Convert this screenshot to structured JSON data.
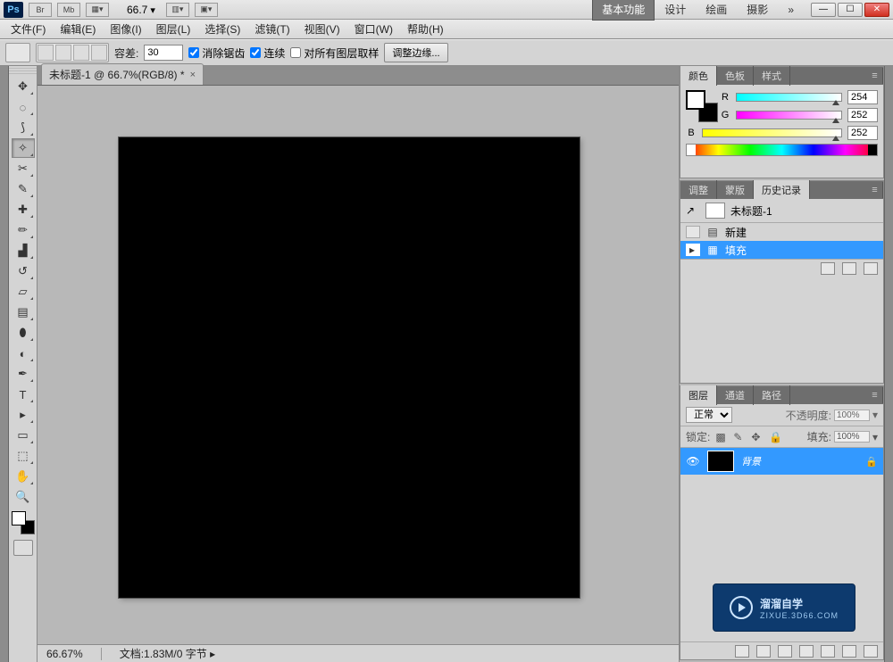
{
  "appbar": {
    "logo": "Ps",
    "br": "Br",
    "mb": "Mb",
    "zoom": "66.7",
    "workspaces": {
      "active": "基本功能",
      "items": [
        "设计",
        "绘画",
        "摄影"
      ],
      "more": "»"
    }
  },
  "menu": {
    "file": "文件(F)",
    "edit": "编辑(E)",
    "image": "图像(I)",
    "layer": "图层(L)",
    "select": "选择(S)",
    "filter": "滤镜(T)",
    "view": "视图(V)",
    "window": "窗口(W)",
    "help": "帮助(H)"
  },
  "options": {
    "tolerance_label": "容差:",
    "tolerance": "30",
    "antialias": "消除锯齿",
    "contiguous": "连续",
    "sample_all": "对所有图层取样",
    "refine": "调整边缘..."
  },
  "document": {
    "tab": "未标题-1 @ 66.7%(RGB/8) *",
    "status_zoom": "66.67%",
    "status_doc": "文档:1.83M/0 字节"
  },
  "color_panel": {
    "tabs": {
      "color": "颜色",
      "swatches": "色板",
      "styles": "样式"
    },
    "r_label": "R",
    "g_label": "G",
    "b_label": "B",
    "r": "254",
    "g": "252",
    "b": "252"
  },
  "adjust_panel": {
    "tabs": {
      "adjust": "调整",
      "masks": "蒙版",
      "history": "历史记录"
    },
    "doc_name": "未标题-1",
    "item_new": "新建",
    "item_fill": "填充"
  },
  "layers_panel": {
    "tabs": {
      "layers": "图层",
      "channels": "通道",
      "paths": "路径"
    },
    "blend": "正常",
    "opacity_label": "不透明度:",
    "opacity": "100%",
    "lock_label": "锁定:",
    "fill_label": "填充:",
    "fill": "100%",
    "layer_name": "背景"
  },
  "watermark": {
    "line1": "溜溜自学",
    "line2": "ZIXUE.3D66.COM"
  }
}
